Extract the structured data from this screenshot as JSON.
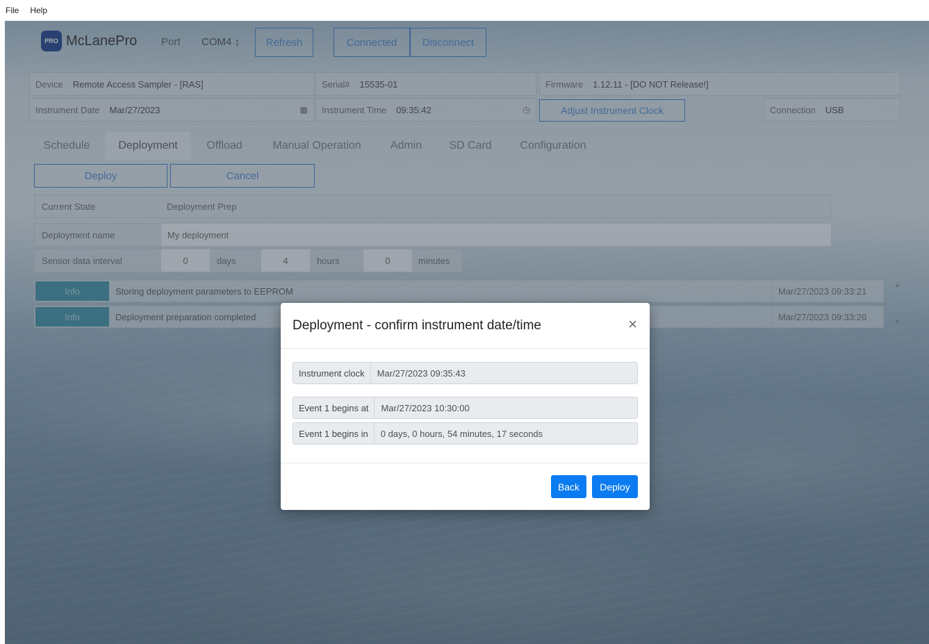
{
  "menubar": {
    "file": "File",
    "help": "Help"
  },
  "header": {
    "logo_mark": "PRO",
    "logo_text": "McLanePro",
    "port_label": "Port",
    "port_value": "COM4 ↕",
    "refresh": "Refresh",
    "connected": "Connected",
    "disconnect": "Disconnect"
  },
  "info": {
    "device_label": "Device",
    "device_value": "Remote Access Sampler - [RAS]",
    "serial_label": "Serial#",
    "serial_value": "15535-01",
    "firmware_label": "Firmware",
    "firmware_value": "1.12.11 - [DO NOT Release!]",
    "date_label": "Instrument Date",
    "date_value": "Mar/27/2023",
    "time_label": "Instrument Time",
    "time_value": "09:35:42",
    "adjust_clock": "Adjust Instrument Clock",
    "connection_label": "Connection",
    "connection_value": "USB"
  },
  "tabs": [
    "Schedule",
    "Deployment",
    "Offload",
    "Manual Operation",
    "Admin",
    "SD Card",
    "Configuration"
  ],
  "actions": {
    "deploy": "Deploy",
    "cancel": "Cancel"
  },
  "form": {
    "state_label": "Current State",
    "state_value": "Deployment Prep",
    "name_label": "Deployment name",
    "name_value": "My deployment",
    "interval_label": "Sensor data interval",
    "days_value": "0",
    "days_unit": "days",
    "hours_value": "4",
    "hours_unit": "hours",
    "minutes_value": "0",
    "minutes_unit": "minutes"
  },
  "log": [
    {
      "level": "Info",
      "message": "Storing deployment parameters to EEPROM",
      "time": "Mar/27/2023 09:33:21"
    },
    {
      "level": "Info",
      "message": "Deployment preparation completed",
      "time": "Mar/27/2023 09:33:26"
    }
  ],
  "modal": {
    "title": "Deployment - confirm instrument date/time",
    "close": "×",
    "rows": [
      {
        "label": "Instrument clock",
        "value": "Mar/27/2023 09:35:43"
      },
      {
        "label": "Event 1 begins at",
        "value": "Mar/27/2023 10:30:00"
      },
      {
        "label": "Event 1 begins in",
        "value": "0 days, 0 hours, 54 minutes, 17 seconds"
      }
    ],
    "back": "Back",
    "deploy": "Deploy"
  },
  "icons": {
    "calendar": "calendar-icon",
    "clock": "clock-icon"
  },
  "colors": {
    "primary": "#0a7bf0",
    "info_badge": "#3d8ea0",
    "link": "#4a86c8"
  }
}
